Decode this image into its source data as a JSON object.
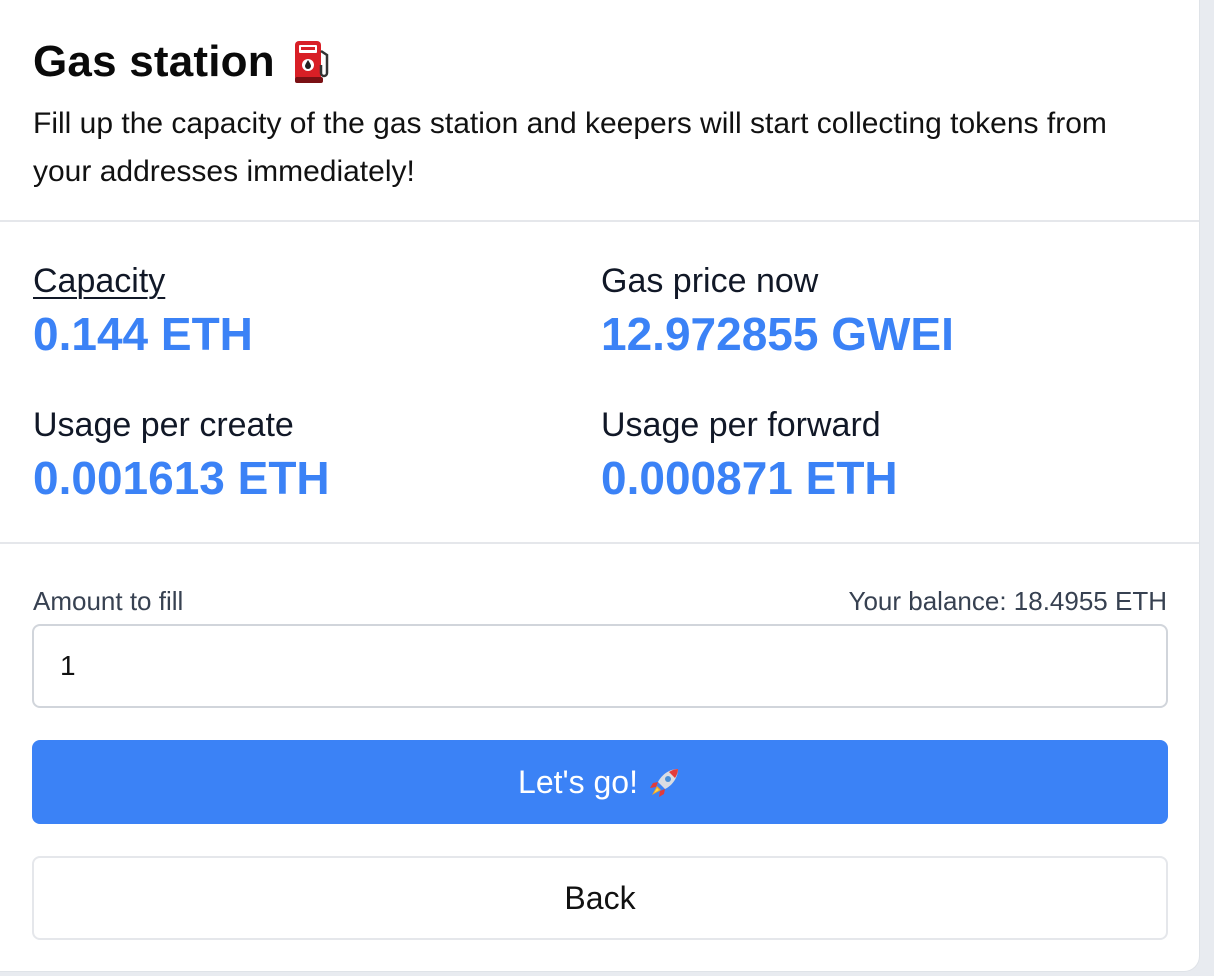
{
  "header": {
    "title": "Gas station",
    "title_icon": "fuel-pump-icon",
    "subtitle": "Fill up the capacity of the gas station and keepers will start collecting tokens from your addresses immediately!"
  },
  "stats": {
    "capacity": {
      "label": "Capacity",
      "value": "0.144 ETH"
    },
    "gas_price": {
      "label": "Gas price now",
      "value": "12.972855 GWEI"
    },
    "usage_create": {
      "label": "Usage per create",
      "value": "0.001613 ETH"
    },
    "usage_forward": {
      "label": "Usage per forward",
      "value": "0.000871 ETH"
    }
  },
  "form": {
    "amount_label": "Amount to fill",
    "balance_text": "Your balance: 18.4955 ETH",
    "amount_value": "1",
    "submit_label": "Let's go!",
    "submit_icon": "rocket-icon",
    "back_label": "Back"
  },
  "colors": {
    "accent": "#3b82f6",
    "text": "#111827",
    "border": "#e5e7eb"
  }
}
